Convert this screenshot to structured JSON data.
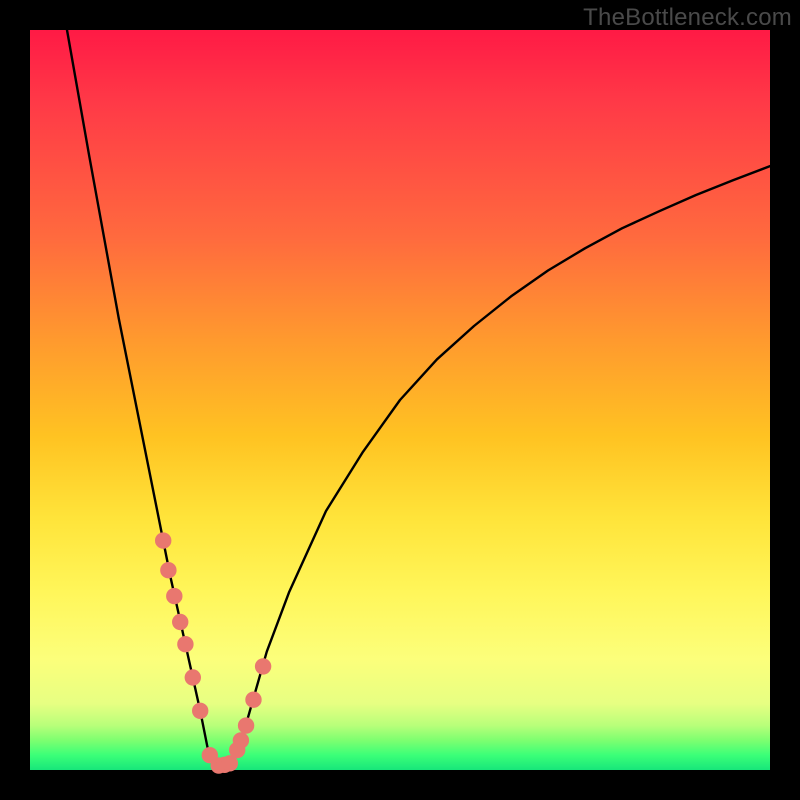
{
  "watermark": "TheBottleneck.com",
  "colors": {
    "background": "#000000",
    "curve_stroke": "#000000",
    "marker_fill": "#e9776f",
    "marker_stroke": "#d15a54",
    "gradient_stops": [
      "#ff1a45",
      "#ff3a47",
      "#ff6a3e",
      "#ff9a2e",
      "#ffc322",
      "#ffe43a",
      "#fff65a",
      "#fcff7b",
      "#e7ff82",
      "#b8ff7a",
      "#7dff70",
      "#3bff78",
      "#17e67a"
    ]
  },
  "chart_data": {
    "type": "line",
    "title": "",
    "xlabel": "",
    "ylabel": "",
    "xlim": [
      0,
      100
    ],
    "ylim": [
      0,
      100
    ],
    "notes": "V-shaped bottleneck curve. y≈100 means severe bottleneck (red), y≈0 means optimal (green). Minimum is near x≈24. Left branch runs roughly from (5,100) down to the floor; right branch rises from the floor toward (100,~82).",
    "series": [
      {
        "name": "bottleneck-curve",
        "x": [
          5,
          8,
          10,
          12,
          14,
          16,
          17,
          18,
          19,
          20,
          21,
          22,
          23,
          24,
          25,
          26,
          27,
          28,
          29,
          30,
          32,
          35,
          40,
          45,
          50,
          55,
          60,
          65,
          70,
          75,
          80,
          85,
          90,
          95,
          100
        ],
        "y": [
          100,
          83,
          72,
          61,
          51,
          41,
          36,
          31,
          26,
          21.5,
          17,
          12.5,
          8,
          3,
          1,
          0.5,
          0.8,
          2.5,
          5.5,
          9,
          16,
          24,
          35,
          43,
          50,
          55.5,
          60,
          64,
          67.5,
          70.5,
          73.2,
          75.5,
          77.7,
          79.7,
          81.6
        ]
      }
    ],
    "markers": {
      "name": "highlighted-range",
      "description": "Salmon beads along the curve near the trough (plot-x roughly 18–32).",
      "x": [
        18.0,
        18.7,
        19.5,
        20.3,
        21.0,
        22.0,
        23.0,
        24.3,
        25.5,
        26.3,
        27.0,
        28.0,
        28.5,
        29.2,
        30.2,
        31.5
      ],
      "y": [
        31.0,
        27.0,
        23.5,
        20.0,
        17.0,
        12.5,
        8.0,
        2.0,
        0.6,
        0.7,
        0.9,
        2.7,
        4.0,
        6.0,
        9.5,
        14.0
      ]
    }
  }
}
